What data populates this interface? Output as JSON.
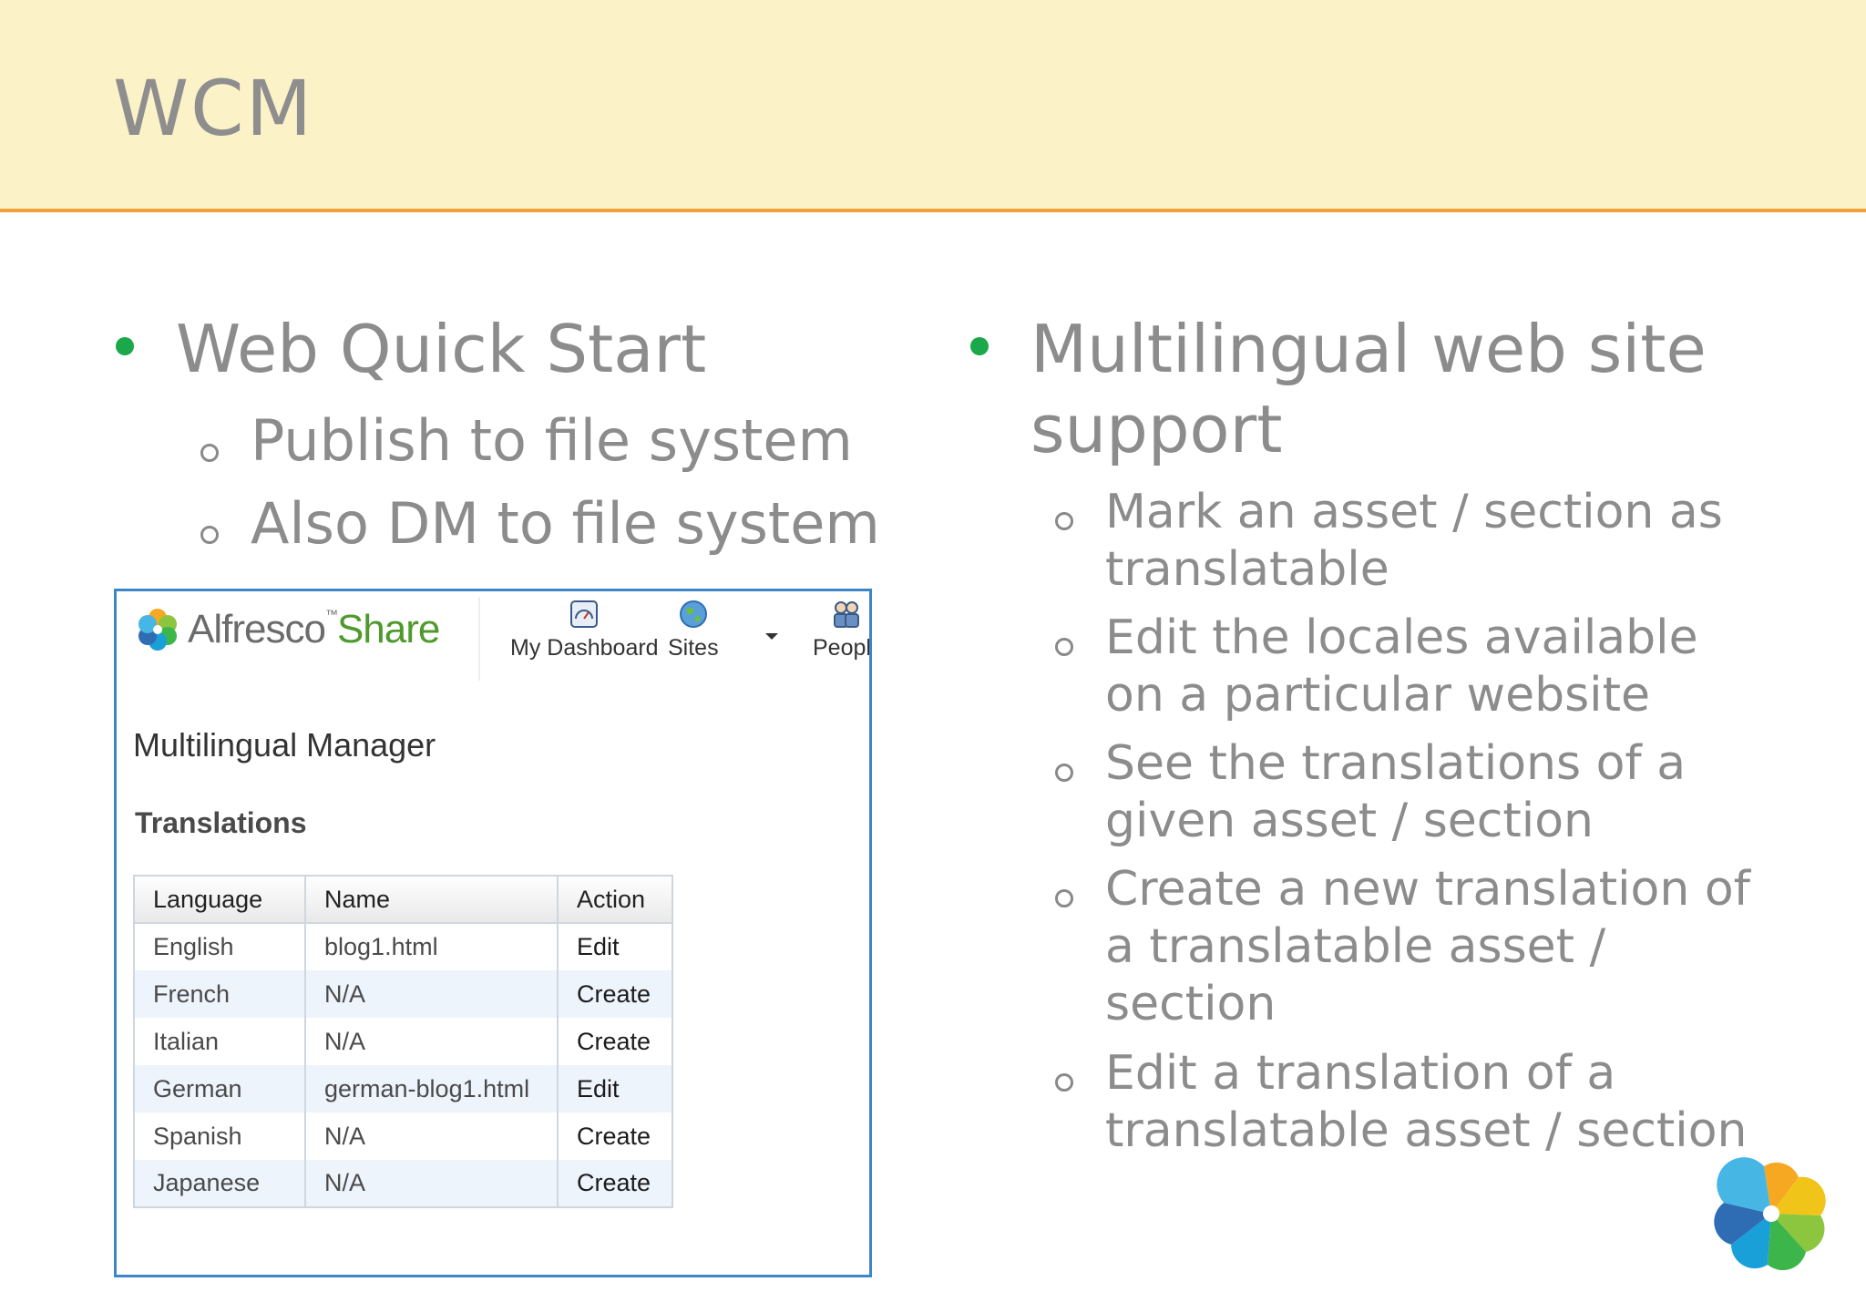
{
  "slide": {
    "title": "WCM",
    "left_bullet": "Web Quick Start",
    "left_sub": [
      "Publish to file system",
      "Also DM to file system"
    ],
    "right_bullet_line1": "Multilingual web site",
    "right_bullet_line2": "support",
    "right_sub": [
      "Mark an asset / section as translatable",
      "Edit the locales available on a particular website",
      "See the translations of a given asset / section",
      "Create a new translation of a translatable asset / section",
      "Edit a translation of a translatable asset / section"
    ]
  },
  "share": {
    "logo_part1": "Alfresco",
    "logo_tm": "™",
    "logo_part2": "Share",
    "nav": [
      "My Dashboard",
      "Sites",
      "People"
    ],
    "page_title": "Multilingual Manager",
    "section_title": "Translations",
    "table": {
      "headers": [
        "Language",
        "Name",
        "Action"
      ],
      "rows": [
        [
          "English",
          "blog1.html",
          "Edit"
        ],
        [
          "French",
          "N/A",
          "Create"
        ],
        [
          "Italian",
          "N/A",
          "Create"
        ],
        [
          "German",
          "german-blog1.html",
          "Edit"
        ],
        [
          "Spanish",
          "N/A",
          "Create"
        ],
        [
          "Japanese",
          "N/A",
          "Create"
        ]
      ]
    }
  },
  "colors": {
    "header_bg": "#fcf2c7",
    "header_rule": "#f0a23a",
    "bullet_green": "#1aa84a",
    "panel_border": "#3d87c9"
  },
  "icons": [
    "alfresco-flower-icon",
    "dashboard-icon",
    "globe-icon",
    "people-icon"
  ]
}
